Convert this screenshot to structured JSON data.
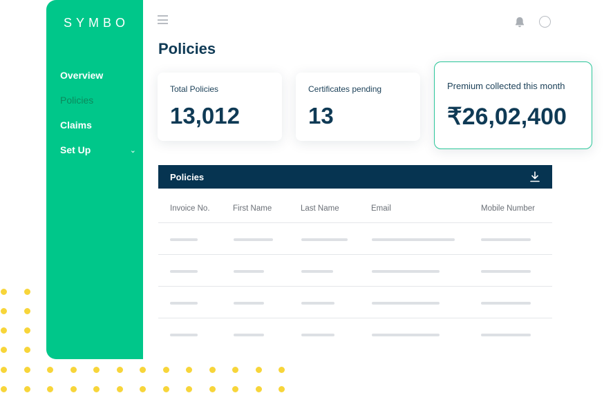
{
  "brand": {
    "name": "SYMBO"
  },
  "sidebar": {
    "items": [
      {
        "label": "Overview",
        "active": false
      },
      {
        "label": "Policies",
        "active": true
      },
      {
        "label": "Claims",
        "active": false
      },
      {
        "label": "Set Up",
        "active": false,
        "chevron": "⌄"
      }
    ]
  },
  "header": {
    "menu_icon": "hamburger-icon",
    "notification_icon": "bell-icon",
    "avatar_icon": "avatar-icon"
  },
  "page": {
    "title": "Policies"
  },
  "stats": [
    {
      "label": "Total Policies",
      "value": "13,012"
    },
    {
      "label": "Certificates pending",
      "value": "13"
    },
    {
      "label": "Premium collected this month",
      "value": "₹26,02,400"
    }
  ],
  "table": {
    "title": "Policies",
    "download_icon": "download-icon",
    "columns": [
      "Invoice No.",
      "First Name",
      "Last Name",
      "Email",
      "Mobile Number"
    ],
    "rows_placeholder_count": 4
  },
  "colors": {
    "sidebar": "#00c78a",
    "table_header": "#063451",
    "accent_border": "#2bc699",
    "dots": "#f7d53a",
    "text_primary": "#0f3a55"
  }
}
